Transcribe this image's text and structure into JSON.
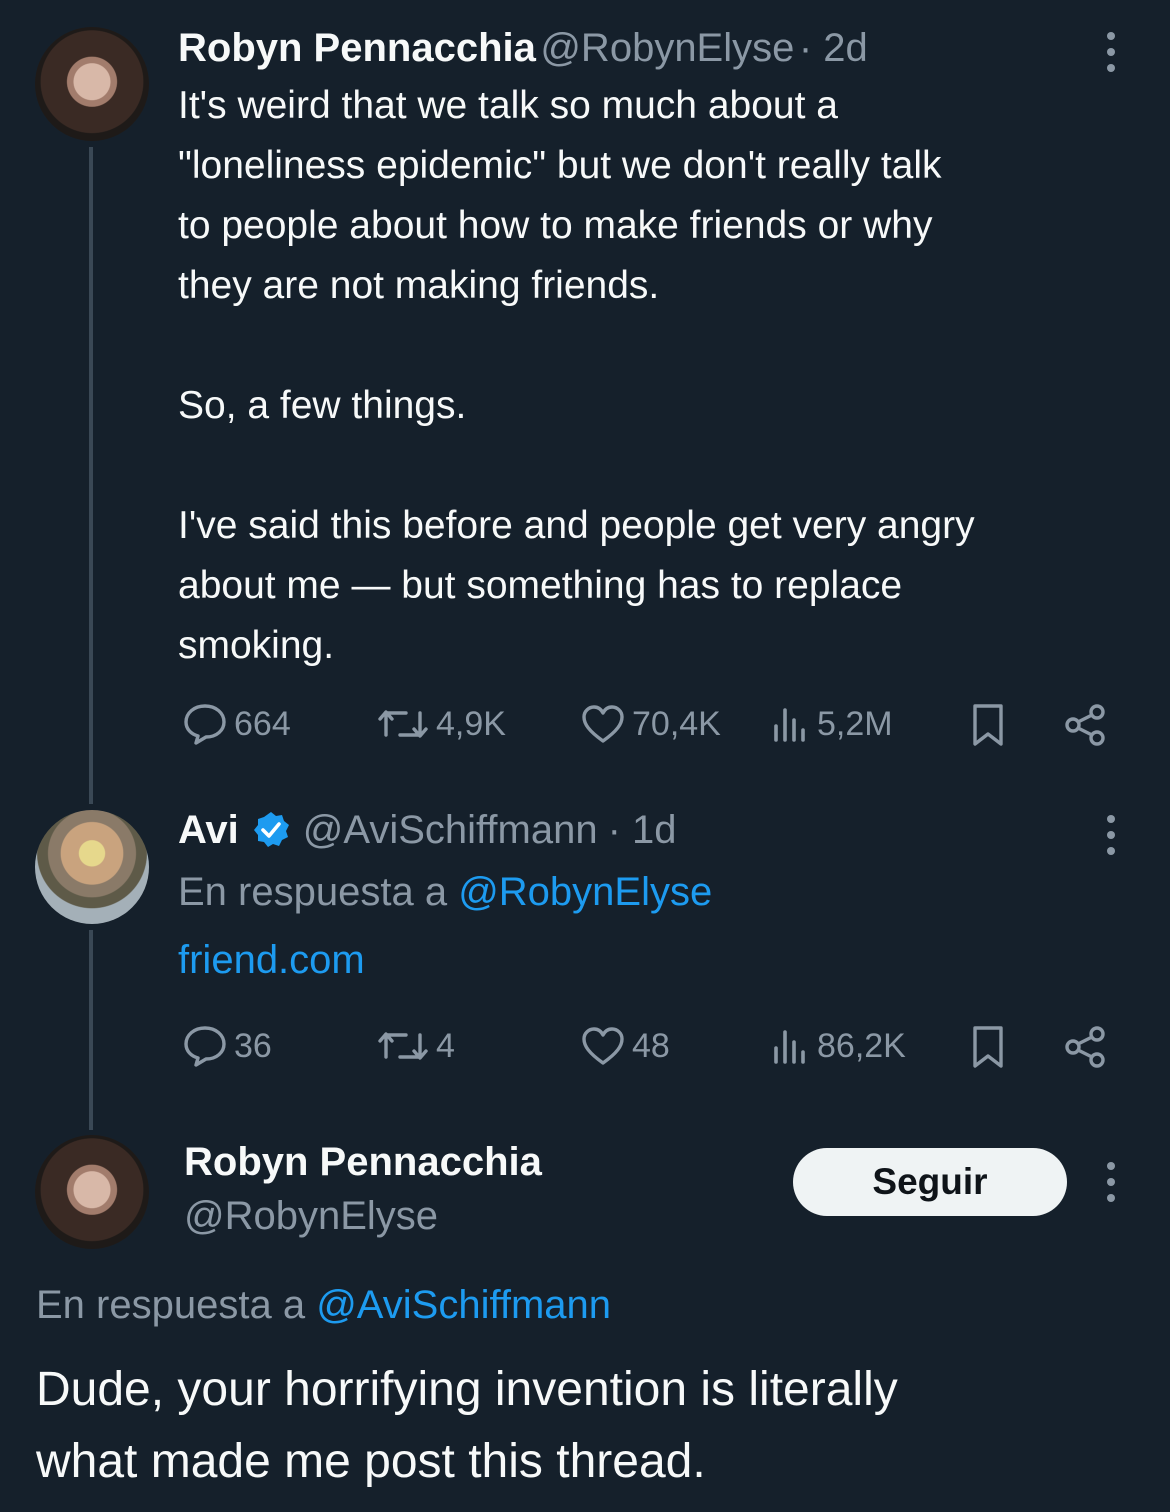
{
  "tweet1": {
    "author_name": "Robyn Pennacchia",
    "author_handle": "@RobynElyse",
    "time": "· 2d",
    "text": "It's weird that we talk so much about a\n\"loneliness epidemic\" but we don't really talk\nto people about how to make friends or why\nthey are not making friends.\n\nSo, a few things.\n\nI've said this before and people get very angry\nabout me — but something has to replace\nsmoking.",
    "stats": {
      "replies": "664",
      "reposts": "4,9K",
      "likes": "70,4K",
      "views": "5,2M"
    }
  },
  "tweet2": {
    "author_name": "Avi",
    "author_handle": "@AviSchiffmann",
    "time": "· 1d",
    "reply_prefix": "En respuesta a",
    "reply_handle": "@RobynElyse",
    "link_text": "friend.com",
    "stats": {
      "replies": "36",
      "reposts": "4",
      "likes": "48",
      "views": "86,2K"
    }
  },
  "tweet3": {
    "author_name": "Robyn Pennacchia",
    "author_handle": "@RobynElyse",
    "follow_label": "Seguir",
    "reply_prefix": "En respuesta a",
    "reply_handle": "@AviSchiffmann",
    "text": "Dude, your horrifying invention is literally\nwhat made me post this thread."
  },
  "icons": {
    "reply": "speech-bubble-icon",
    "repost": "repost-arrows-icon",
    "like": "heart-icon",
    "views": "bar-chart-icon",
    "bookmark": "bookmark-icon",
    "share": "share-icon",
    "verified": "verified-badge-icon",
    "more": "more-dots-icon"
  },
  "colors": {
    "background": "#15202b",
    "accent": "#1d9bf0",
    "muted": "#8b98a5",
    "text": "#f7f9f9"
  }
}
